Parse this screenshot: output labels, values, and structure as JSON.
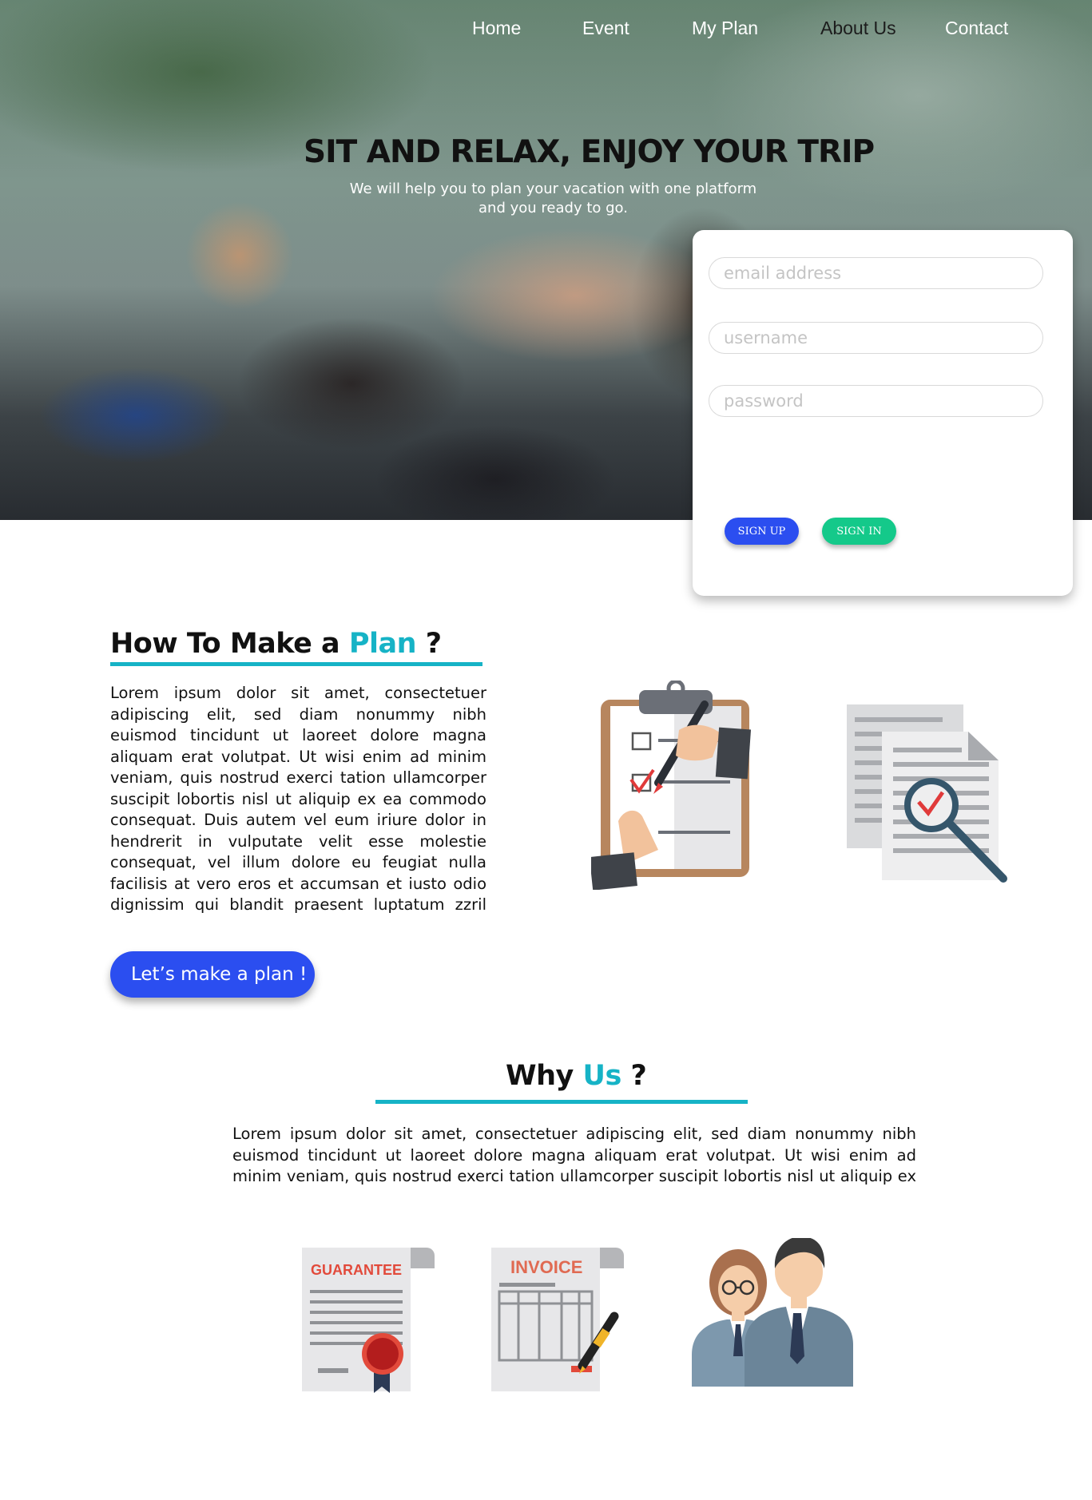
{
  "nav": {
    "items": [
      "Home",
      "Event",
      "My Plan",
      "About Us",
      "Contact"
    ]
  },
  "hero": {
    "title": "SIT AND RELAX, ENJOY YOUR TRIP",
    "subtitle_line1": "We will help you to plan your vacation with one platform",
    "subtitle_line2": "and you ready to go."
  },
  "form": {
    "email_placeholder": "email address",
    "username_placeholder": "username",
    "password_placeholder": "password",
    "signup_label": "SIGN UP",
    "signin_label": "SIGN IN",
    "signup_color": "#2b4ef0",
    "signin_color": "#14c98a"
  },
  "how_to": {
    "title_prefix": "How To Make a ",
    "title_accent": "Plan",
    "title_suffix": " ?",
    "body": "Lorem ipsum dolor sit amet, consectetuer adipiscing elit, sed diam nonummy nibh euismod tincidunt ut laoreet dolore magna aliquam erat volutpat. Ut wisi enim ad minim veniam, quis nostrud exerci tation ullamcorper suscipit lobortis nisl ut aliquip ex ea commodo consequat. Duis autem vel eum iriure dolor in hendrerit in vulputate velit esse molestie consequat, vel illum dolore eu feugiat nulla facilisis at vero eros et accumsan et iusto odio dignissim qui blandit praesent luptatum zzril delenit augue duis dolore te",
    "cta_label": "Let’s make a plan !"
  },
  "why_us": {
    "title_prefix": "Why ",
    "title_accent": "Us",
    "title_suffix": " ?",
    "body": "Lorem ipsum dolor sit amet, consectetuer adipiscing elit, sed diam nonummy nibh euismod tincidunt ut laoreet dolore magna aliquam erat volutpat. Ut wisi enim ad minim veniam, quis nostrud exerci tation ullamcorper suscipit lobortis nisl ut aliquip ex ea com-",
    "guarantee_label": "GUARANTEE",
    "invoice_label": "INVOICE"
  },
  "colors": {
    "accent": "#16b3c6",
    "primary_button": "#2b4ef0"
  },
  "icons": [
    "clipboard-checklist-icon",
    "document-search-icon",
    "guarantee-certificate-icon",
    "invoice-pen-icon",
    "business-people-icon"
  ]
}
